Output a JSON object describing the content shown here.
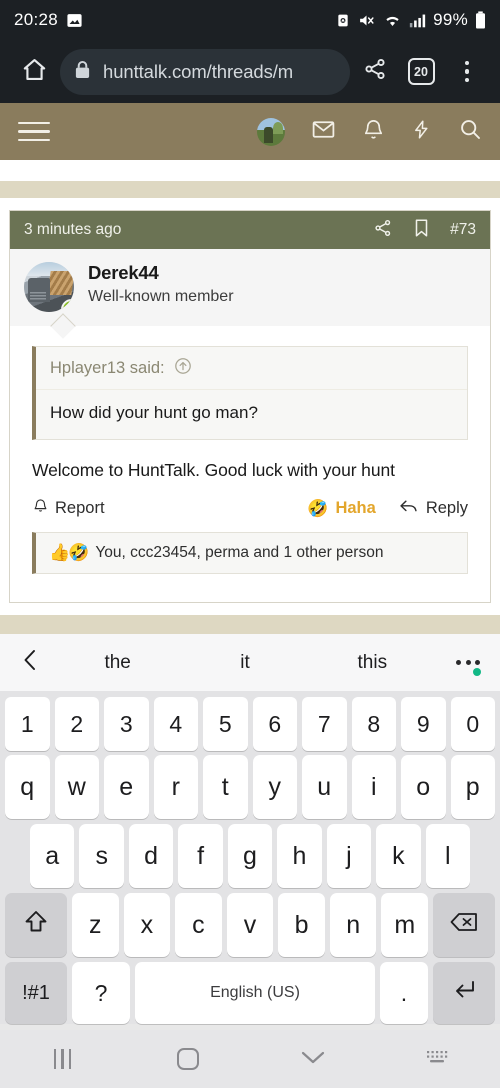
{
  "status_bar": {
    "time": "20:28",
    "icons": [
      "image-icon",
      "sim-icon",
      "mute-icon",
      "wifi-icon",
      "signal-icon"
    ],
    "battery_percent": "99%"
  },
  "browser": {
    "home_icon": "home-icon",
    "lock_icon": "lock-icon",
    "url": "hunttalk.com/threads/m",
    "share_icon": "share-icon",
    "tab_count": "20",
    "menu_icon": "kebab-menu-icon"
  },
  "site_nav": {
    "menu_icon": "hamburger-icon",
    "avatar_icon": "user-avatar-icon",
    "mail_icon": "mail-icon",
    "bell_icon": "bell-icon",
    "bolt_icon": "lightning-icon",
    "search_icon": "search-icon"
  },
  "post": {
    "timestamp": "3 minutes ago",
    "share_icon": "share-nodes-icon",
    "bookmark_icon": "bookmark-icon",
    "post_number": "#73",
    "author": "Derek44",
    "author_title": "Well-known member",
    "online_badge": "online-status-icon",
    "quote": {
      "attribution": "Hplayer13 said:",
      "jump_icon": "jump-to-post-icon",
      "text": "How did your hunt go man?"
    },
    "body": "Welcome to HuntTalk. Good luck with your hunt",
    "actions": {
      "report_label": "Report",
      "report_icon": "bell-icon",
      "reaction_label": "Haha",
      "reaction_emoji": "🤣",
      "reaction_color": "#e3a62c",
      "reply_label": "Reply",
      "reply_icon": "reply-arrow-icon"
    },
    "reactions": {
      "emojis": [
        "👍",
        "🤣"
      ],
      "text": "You, ccc23454, perma and 1 other person"
    }
  },
  "keyboard": {
    "back_icon": "chevron-left-icon",
    "suggestions": [
      "the",
      "it",
      "this"
    ],
    "more_icon": "overflow-dots-icon",
    "row_numbers": [
      "1",
      "2",
      "3",
      "4",
      "5",
      "6",
      "7",
      "8",
      "9",
      "0"
    ],
    "row_top": [
      "q",
      "w",
      "e",
      "r",
      "t",
      "y",
      "u",
      "i",
      "o",
      "p"
    ],
    "row_home": [
      "a",
      "s",
      "d",
      "f",
      "g",
      "h",
      "j",
      "k",
      "l"
    ],
    "row_bottom": [
      "z",
      "x",
      "c",
      "v",
      "b",
      "n",
      "m"
    ],
    "shift_icon": "shift-icon",
    "backspace_icon": "backspace-icon",
    "symbols_label": "!#1",
    "question_label": "?",
    "space_label": "English (US)",
    "period_label": ".",
    "enter_icon": "enter-icon"
  },
  "android_nav": {
    "recents_icon": "recents-icon",
    "home_icon": "home-square-icon",
    "hide_keyboard_icon": "chevron-down-icon",
    "keyboard_switch_icon": "keyboard-switch-icon"
  }
}
